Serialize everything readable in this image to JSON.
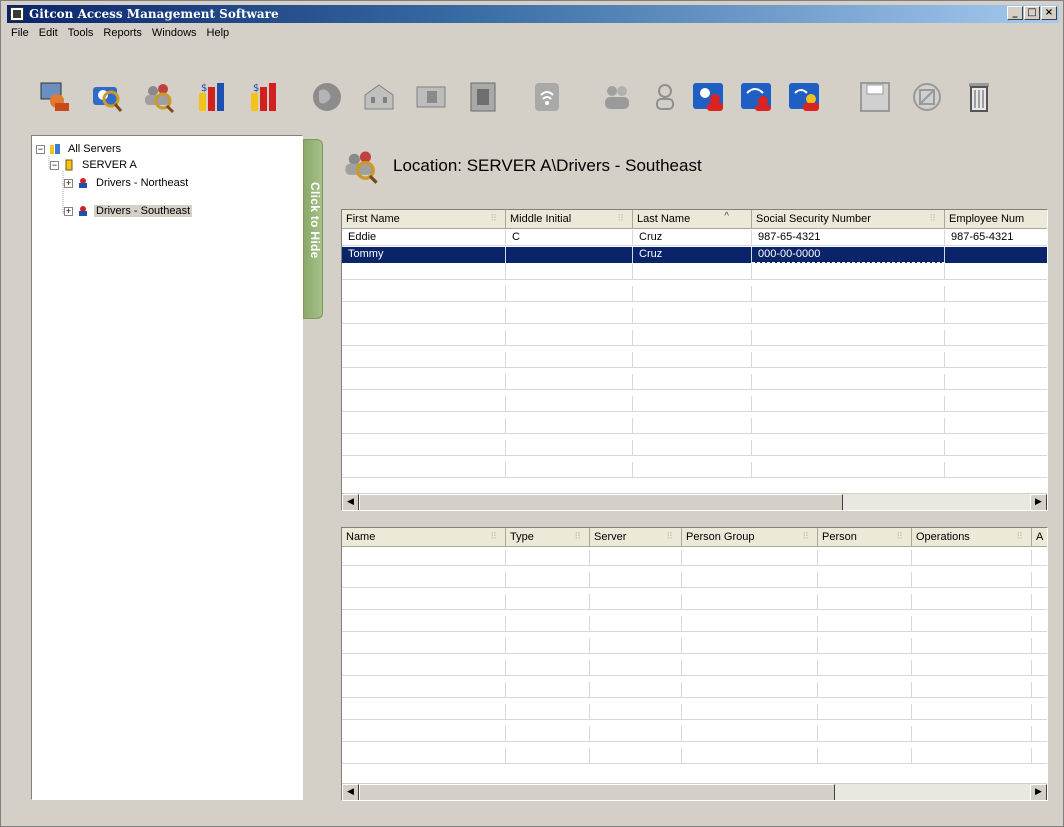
{
  "window": {
    "title": "Gitcon Access Management Software",
    "minimize_label": "_",
    "maximize_label": "□",
    "close_label": "×"
  },
  "menu": [
    {
      "label": "File"
    },
    {
      "label": "Edit"
    },
    {
      "label": "Tools"
    },
    {
      "label": "Reports"
    },
    {
      "label": "Windows"
    },
    {
      "label": "Help"
    }
  ],
  "toolbar": {
    "buttons": [
      {
        "icon": "import-person-icon",
        "enabled": true
      },
      {
        "icon": "search-person-icon",
        "enabled": true
      },
      {
        "icon": "find-group-icon",
        "enabled": true
      },
      {
        "icon": "report-chart-icon",
        "enabled": true
      },
      {
        "icon": "report-chart-alt-icon",
        "enabled": true
      },
      {
        "icon": "globe-icon",
        "enabled": false
      },
      {
        "icon": "building-icon",
        "enabled": false
      },
      {
        "icon": "controller-icon",
        "enabled": false
      },
      {
        "icon": "panel-icon",
        "enabled": false
      },
      {
        "icon": "wireless-reader-icon",
        "enabled": false
      },
      {
        "icon": "people-group-icon",
        "enabled": false
      },
      {
        "icon": "person-icon",
        "enabled": false
      },
      {
        "icon": "group-access-icon",
        "enabled": true
      },
      {
        "icon": "wireless-group-icon",
        "enabled": true
      },
      {
        "icon": "group-access-alt-icon",
        "enabled": true
      },
      {
        "icon": "save-icon",
        "enabled": false
      },
      {
        "icon": "cancel-icon",
        "enabled": false
      },
      {
        "icon": "trash-icon",
        "enabled": true
      }
    ]
  },
  "tree": {
    "root": "All Servers",
    "server": "SERVER A",
    "groups": [
      "Drivers - Northeast",
      "Drivers - Southeast"
    ],
    "selected_group": "Drivers - Southeast"
  },
  "hide_tab_label": "Click to Hide",
  "location": {
    "text": "Location: SERVER A\\Drivers - Southeast"
  },
  "persons_grid": {
    "columns": [
      "First Name",
      "Middle Initial",
      "Last Name",
      "Social Security Number",
      "Employee Num"
    ],
    "sort_indicator": "^",
    "rows": [
      [
        "Eddie",
        "C",
        "Cruz",
        "987-65-4321",
        "987-65-4321"
      ],
      [
        "Tommy",
        "",
        "Cruz",
        "000-00-0000",
        ""
      ]
    ],
    "selected_row": 1
  },
  "access_grid": {
    "columns": [
      "Name",
      "Type",
      "Server",
      "Person Group",
      "Person",
      "Operations",
      "A"
    ],
    "rows": []
  }
}
